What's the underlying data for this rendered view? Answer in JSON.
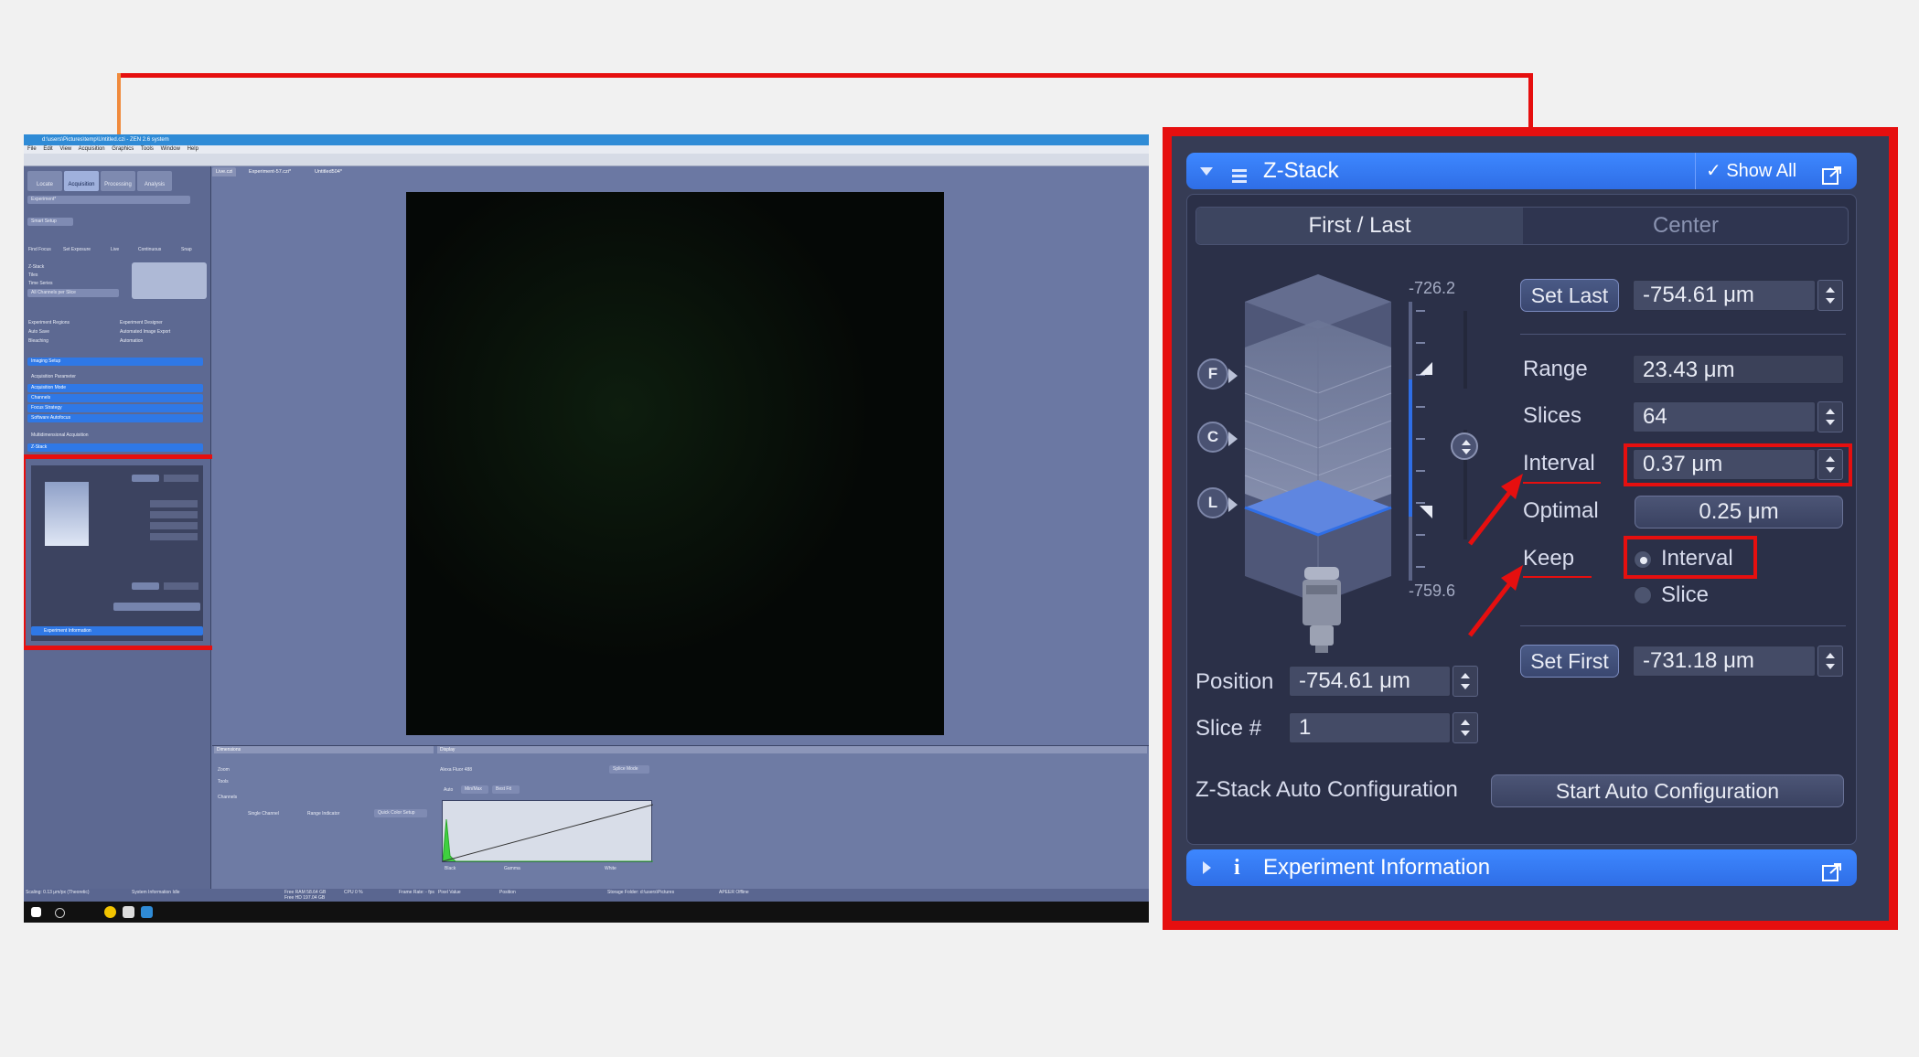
{
  "app": {
    "title_bar": "d:\\users\\Pictures\\temp\\Untitled.czi - ZEN 2.6 system",
    "menus": [
      "File",
      "Edit",
      "View",
      "Acquisition",
      "Graphics",
      "Tools",
      "Window",
      "Help"
    ],
    "main_tabs": [
      "Locate",
      "Acquisition",
      "Processing",
      "Analysis"
    ],
    "doc_tabs": [
      "Live.czi",
      "Experiment-57.czi*",
      "Untitled504*"
    ],
    "left_items": [
      "Experiment*",
      "Smart Setup",
      "Find Focus",
      "Set Exposure",
      "Live",
      "Continuous",
      "Snap",
      "Z-Stack",
      "Tiles",
      "Time Series",
      "All Channels per Slice",
      "Experiment Regions",
      "Auto Save",
      "Bleaching",
      "Experiment Designer",
      "Automated Image Export",
      "Automation",
      "Imaging Setup",
      "Acquisition Parameter",
      "Acquisition Mode",
      "Channels",
      "Focus Strategy",
      "Software Autofocus",
      "Multidimensional Acquisition",
      "Z-Stack",
      "Experiment Information"
    ],
    "bottom_labels": [
      "Dimensions",
      "Display",
      "Zoom",
      "Tools",
      "Channels",
      "Alexa Fluor 488",
      "Splice Mode",
      "Auto",
      "Min/Max",
      "Best Fit",
      "Black",
      "Gamma",
      "White",
      "Single Channel",
      "Range Indicator",
      "Quick Color Setup"
    ],
    "status": [
      "Scaling: 0.13 μm/px (Theoretic)",
      "System Information Idle",
      "Free RAM 58.64 GB",
      "Free HD 197.04 GB",
      "CPU 0 %",
      "Frame Rate: - fps",
      "Pixel Value",
      "Position",
      "Storage Folder: d:\\users\\Pictures",
      "APEER Offline"
    ]
  },
  "zstack": {
    "header_title": "Z-Stack",
    "show_all_label": "Show All",
    "tabs": {
      "active": "First / Last",
      "inactive": "Center"
    },
    "scale_top": "-726.2",
    "scale_bottom": "-759.6",
    "buttons": {
      "f": "F",
      "c": "C",
      "l": "L"
    },
    "set_last": {
      "label": "Set Last",
      "value": "-754.61 μm"
    },
    "range": {
      "label": "Range",
      "value": "23.43 μm"
    },
    "slices": {
      "label": "Slices",
      "value": "64"
    },
    "interval": {
      "label": "Interval",
      "value": "0.37 μm"
    },
    "optimal": {
      "label": "Optimal",
      "value": "0.25 μm"
    },
    "keep": {
      "label": "Keep",
      "options": [
        "Interval",
        "Slice"
      ],
      "selected": "Interval"
    },
    "set_first": {
      "label": "Set First",
      "value": "-731.18 μm"
    },
    "position": {
      "label": "Position",
      "value": "-754.61 μm"
    },
    "slice_no": {
      "label": "Slice #",
      "value": "1"
    },
    "auto_config": {
      "label": "Z-Stack Auto Configuration",
      "button": "Start Auto Configuration"
    },
    "experiment_info_title": "Experiment Information"
  },
  "colors": {
    "highlight": "#e60f0f",
    "connector": "#f08a3c",
    "header_blue": "#3d87ff",
    "panel_bg": "#363c55"
  },
  "icons": [
    "list-icon",
    "check-icon",
    "popout-icon",
    "info-icon",
    "chevron-down-icon",
    "chevron-right-icon",
    "stepper-icon",
    "objective-icon",
    "windows-logo-icon"
  ]
}
